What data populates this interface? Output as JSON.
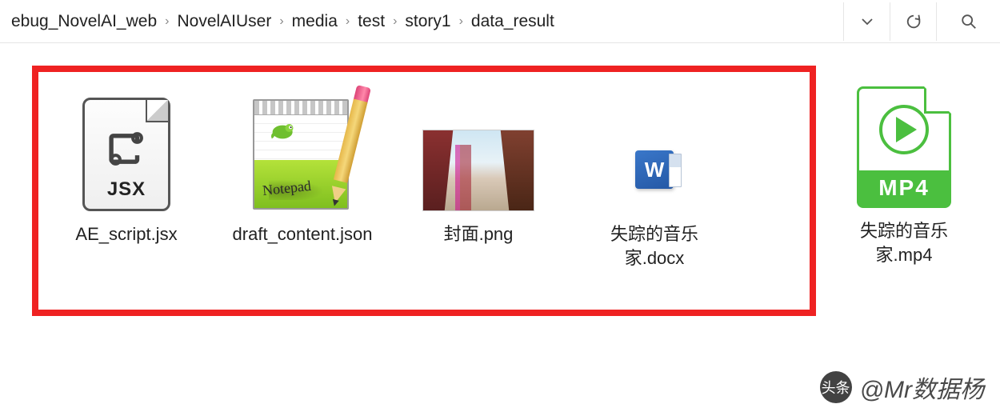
{
  "breadcrumb": {
    "items": [
      "ebug_NovelAI_web",
      "NovelAIUser",
      "media",
      "test",
      "story1",
      "data_result"
    ]
  },
  "toolbar": {
    "collapse_label": "v",
    "refresh_label": "refresh",
    "search_label": "search"
  },
  "files": {
    "jsx": {
      "name": "AE_script.jsx",
      "badge": "JSX"
    },
    "json": {
      "name": "draft_content.json",
      "app": "Notepad++",
      "script_text": "Notepad"
    },
    "png": {
      "name": "封面.png"
    },
    "docx": {
      "name": "失踪的音乐家.docx",
      "letter": "W"
    },
    "mp4": {
      "name": "失踪的音乐家.mp4",
      "badge": "MP4"
    }
  },
  "watermark": {
    "prefix": "头条",
    "text": "@Mr数据杨"
  }
}
